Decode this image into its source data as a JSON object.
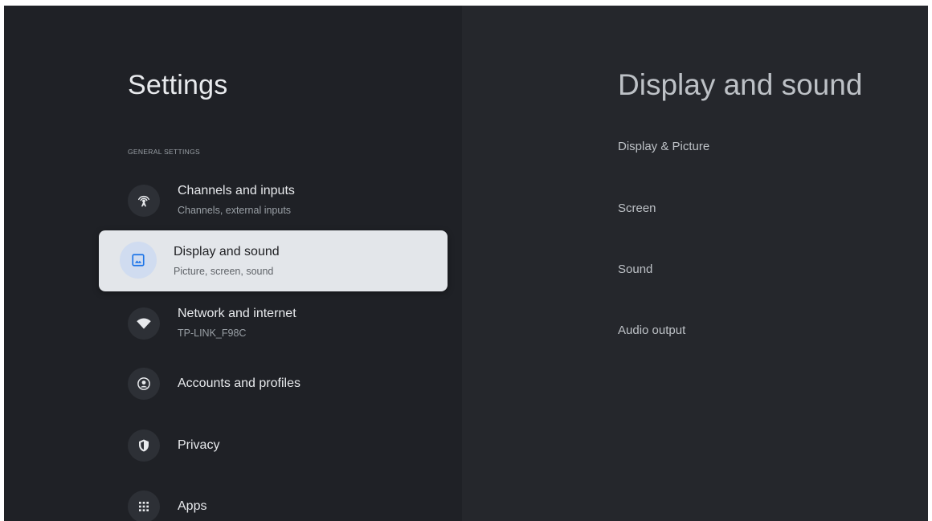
{
  "settings": {
    "title": "Settings",
    "section_label": "GENERAL SETTINGS",
    "items": [
      {
        "title": "Channels and inputs",
        "subtitle": "Channels, external inputs",
        "icon": "antenna-icon"
      },
      {
        "title": "Display and sound",
        "subtitle": "Picture, screen, sound",
        "icon": "image-icon"
      },
      {
        "title": "Network and internet",
        "subtitle": "TP-LINK_F98C",
        "icon": "wifi-icon"
      },
      {
        "title": "Accounts and profiles",
        "icon": "account-icon"
      },
      {
        "title": "Privacy",
        "icon": "shield-icon"
      },
      {
        "title": "Apps",
        "icon": "apps-grid-icon"
      }
    ]
  },
  "detail": {
    "title": "Display and sound",
    "items": [
      "Display & Picture",
      "Screen",
      "Sound",
      "Audio output"
    ]
  },
  "colors": {
    "background": "#1f2126",
    "right_panel": "#25272c",
    "selected_item": "#e3e6ea",
    "selected_icon_bg": "#d0dcf0",
    "accent_blue": "#1a73e8"
  }
}
